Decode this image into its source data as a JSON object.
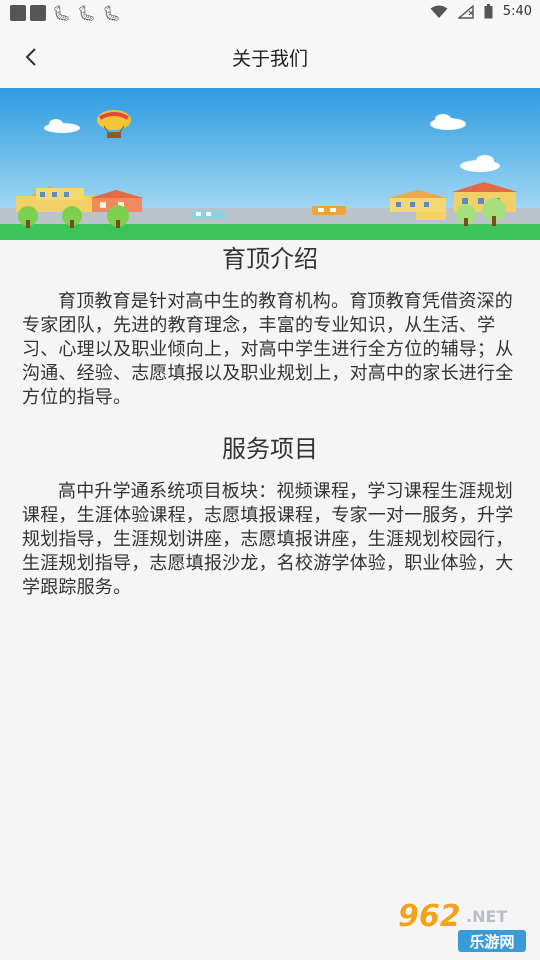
{
  "status": {
    "icons_left": [
      "bug-icon",
      "bug-icon",
      "bug-icon"
    ],
    "time": "5:40"
  },
  "header": {
    "title": "关于我们"
  },
  "sections": [
    {
      "title": "育顶介绍",
      "body": "育顶教育是针对高中生的教育机构。育顶教育凭借资深的专家团队，先进的教育理念，丰富的专业知识，从生活、学习、心理以及职业倾向上，对高中学生进行全方位的辅导；从沟通、经验、志愿填报以及职业规划上，对高中的家长进行全方位的指导。"
    },
    {
      "title": "服务项目",
      "body": "高中升学通系统项目板块：视频课程，学习课程生涯规划课程，生涯体验课程，志愿填报课程，专家一对一服务，升学规划指导，生涯规划讲座，志愿填报讲座，生涯规划校园行，生涯规划指导，志愿填报沙龙，名校游学体验，职业体验，大学跟踪服务。"
    }
  ],
  "watermark": {
    "top": "962",
    "net": ".NET",
    "bottom": "乐游网"
  },
  "colors": {
    "sky_top": "#2c9be0",
    "sky_bottom": "#bfe6f7",
    "grass": "#3cc35a",
    "road": "#b9c3c9"
  }
}
